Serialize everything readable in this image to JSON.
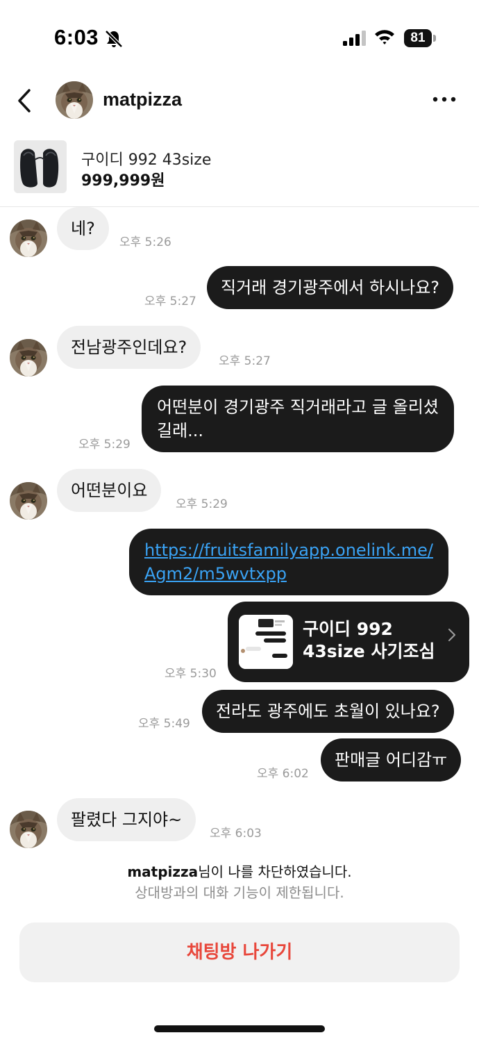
{
  "status_bar": {
    "time": "6:03",
    "battery": "81"
  },
  "header": {
    "username": "matpizza",
    "back_icon": "chevron-left-icon",
    "more_icon": "ellipsis-icon"
  },
  "product": {
    "title": "구이디 992 43size",
    "price": "999,999원"
  },
  "messages": [
    {
      "sender": "other",
      "text": "네?",
      "time": "오후 5:26"
    },
    {
      "sender": "me",
      "text": "직거래 경기광주에서 하시나요?",
      "time": "오후 5:27"
    },
    {
      "sender": "other",
      "text": "전남광주인데요?",
      "time": "오후 5:27"
    },
    {
      "sender": "me",
      "lines": [
        "어떤분이 경기광주 직거래라고 글 올리셨",
        "길래..."
      ],
      "time": "오후 5:29"
    },
    {
      "sender": "other",
      "text": "어떤분이요",
      "time": "오후 5:29"
    },
    {
      "sender": "me",
      "link_lines": [
        "https://fruitsfamilyapp.onelink.me/",
        "Agm2/m5wvtxpp"
      ]
    },
    {
      "sender": "me",
      "share_card": {
        "lines": [
          "구이디 992",
          "43size 사기조심"
        ]
      },
      "time": "오후 5:30"
    },
    {
      "sender": "me",
      "text": "전라도 광주에도 초월이 있나요?",
      "time": "오후 5:49"
    },
    {
      "sender": "me",
      "text": "판매글 어디감ㅠ",
      "time": "오후 6:02"
    },
    {
      "sender": "other",
      "text": "팔렸다 그지야~",
      "time": "오후 6:03"
    }
  ],
  "block_notice": {
    "name": "matpizza",
    "line1_suffix": "님이 나를 차단하였습니다.",
    "line2": "상대방과의 대화 기능이 제한됩니다."
  },
  "leave_button": {
    "label": "채팅방 나가기"
  },
  "colors": {
    "incoming_bubble": "#efefef",
    "outgoing_bubble": "#1b1b1b",
    "link": "#3aa3f5",
    "leave_text": "#e8473b"
  }
}
